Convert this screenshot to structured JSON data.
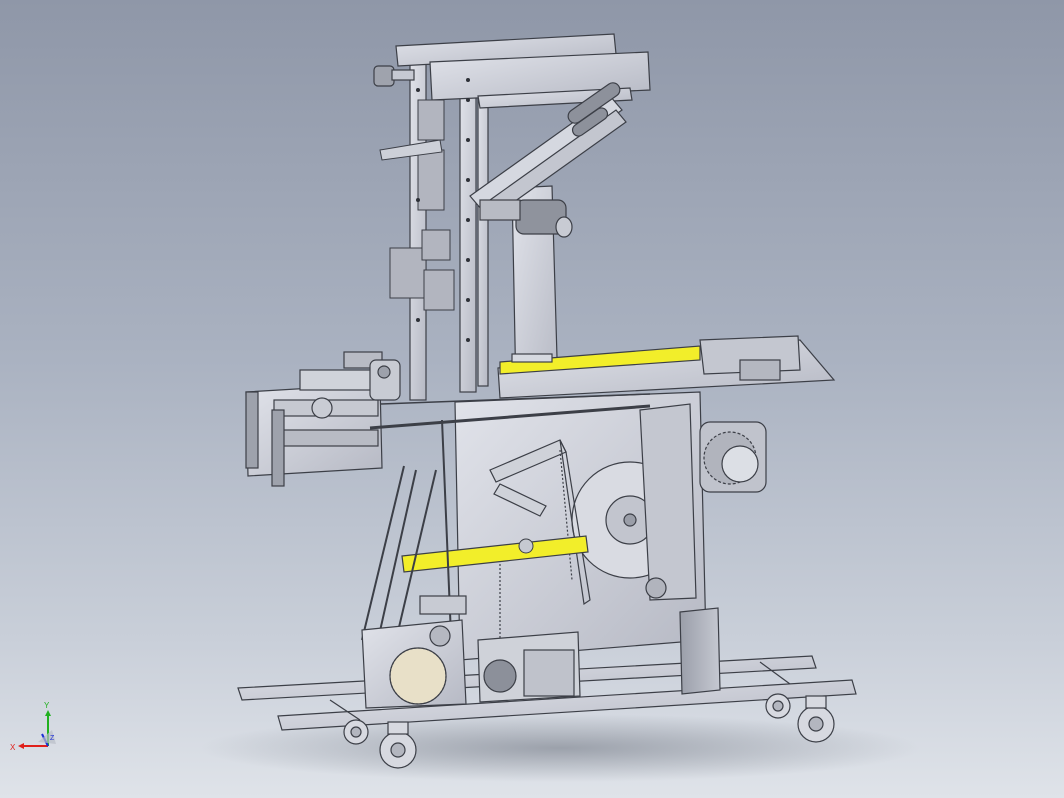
{
  "viewport": {
    "background_top": "#8f97a8",
    "background_bottom": "#dfe3e9"
  },
  "model": {
    "metal_color": "#c9ccd6",
    "edge_color": "#3c3f47",
    "highlight_color": "#f2ee2a"
  },
  "triad": {
    "x_label": "X",
    "y_label": "Y",
    "z_label": "Z",
    "x_color": "#e0201b",
    "y_color": "#21b01f",
    "z_color": "#1d2fd6"
  }
}
